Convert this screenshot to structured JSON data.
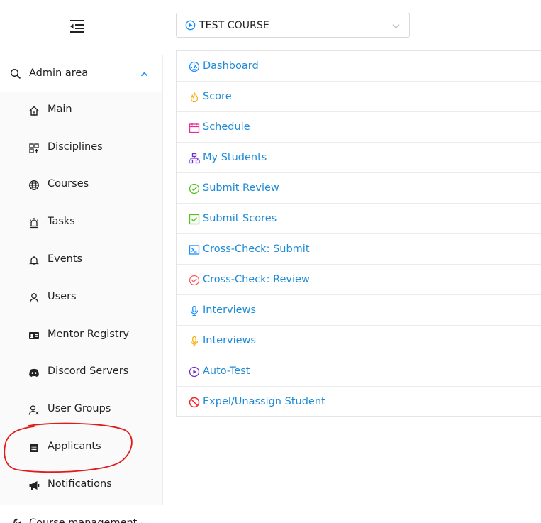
{
  "header": {
    "fold_icon": "menu-fold-icon",
    "course_select": {
      "value": "TEST COURSE",
      "icon": "play-circle-icon"
    }
  },
  "sidebar": {
    "section": {
      "label": "Admin area",
      "icon": "search-icon",
      "expanded": true
    },
    "items": [
      {
        "label": "Main",
        "icon": "home-icon"
      },
      {
        "label": "Disciplines",
        "icon": "appstore-icon"
      },
      {
        "label": "Courses",
        "icon": "global-icon"
      },
      {
        "label": "Tasks",
        "icon": "alert-icon"
      },
      {
        "label": "Events",
        "icon": "bell-icon"
      },
      {
        "label": "Users",
        "icon": "user-icon"
      },
      {
        "label": "Mentor Registry",
        "icon": "idcard-icon"
      },
      {
        "label": "Discord Servers",
        "icon": "discord-icon"
      },
      {
        "label": "User Groups",
        "icon": "usergroup-icon"
      },
      {
        "label": "Applicants",
        "icon": "profile-icon"
      },
      {
        "label": "Notifications",
        "icon": "notification-icon"
      }
    ],
    "section2": {
      "label": "Course management",
      "icon": "tool-icon",
      "expanded": false
    }
  },
  "links": [
    {
      "label": "Dashboard",
      "icon": "dashboard-icon",
      "color": "#1890ff"
    },
    {
      "label": "Score",
      "icon": "fire-icon",
      "color": "#faad14"
    },
    {
      "label": "Schedule",
      "icon": "calendar-icon",
      "color": "#eb2f96"
    },
    {
      "label": "My Students",
      "icon": "apartment-icon",
      "color": "#722ed1"
    },
    {
      "label": "Submit Review",
      "icon": "check-circle-icon",
      "color": "#52c41a"
    },
    {
      "label": "Submit Scores",
      "icon": "check-square-icon",
      "color": "#52c41a"
    },
    {
      "label": "Cross-Check: Submit",
      "icon": "code-icon",
      "color": "#1890ff"
    },
    {
      "label": "Cross-Check: Review",
      "icon": "check-circle-icon",
      "color": "#f5222d"
    },
    {
      "label": "Interviews",
      "icon": "audio-icon",
      "color": "#1890ff"
    },
    {
      "label": "Interviews",
      "icon": "audio-icon",
      "color": "#faad14"
    },
    {
      "label": "Auto-Test",
      "icon": "play-circle-icon",
      "color": "#722ed1"
    },
    {
      "label": "Expel/Unassign Student",
      "icon": "stop-icon",
      "color": "#f5222d"
    }
  ]
}
